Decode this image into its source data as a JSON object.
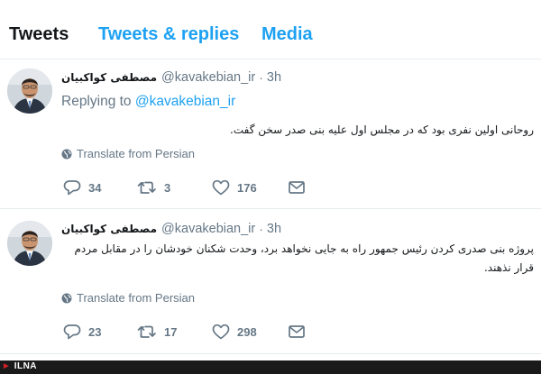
{
  "tabs": [
    {
      "label": "Tweets",
      "active": true
    },
    {
      "label": "Tweets & replies",
      "active": false
    },
    {
      "label": "Media",
      "active": false
    }
  ],
  "tweets": [
    {
      "name": "مصطفی کواکبیان",
      "handle": "@kavakebian_ir",
      "separator": "·",
      "time": "3h",
      "replying_prefix": "Replying to",
      "replying_handle": "@kavakebian_ir",
      "text": "روحانی اولین نفری بود که در مجلس اول علیه بنی صدر سخن گفت.",
      "translate": "Translate from Persian",
      "replies": "34",
      "retweets": "3",
      "likes": "176"
    },
    {
      "name": "مصطفی کواکبیان",
      "handle": "@kavakebian_ir",
      "separator": "·",
      "time": "3h",
      "text": "پروژه بنی صدری کردن رئیس جمهور راه به جایی نخواهد برد، وحدت شکنان خودشان را در مقابل مردم قرار نذهند.",
      "translate": "Translate from Persian",
      "replies": "23",
      "retweets": "17",
      "likes": "298"
    }
  ],
  "footer": {
    "logo": "ILNA"
  },
  "colors": {
    "accent": "#1da1f2",
    "muted": "#657786",
    "text": "#14171a",
    "border": "#e6ecf0"
  }
}
